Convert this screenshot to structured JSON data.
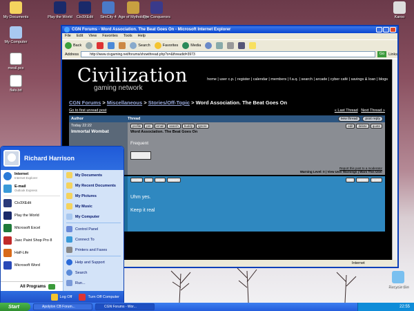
{
  "desktop": {
    "icons": [
      {
        "label": "My Documents",
        "color": "#f4d35e"
      },
      {
        "label": "My Computer",
        "color": "#a8c8f0"
      },
      {
        "label": "mesil.pcx",
        "color": "#ffffff"
      },
      {
        "label": "flats.txt",
        "color": "#ffffff"
      },
      {
        "label": "Play the World",
        "color": "#1a2a6a"
      },
      {
        "label": "Civ3XEdit",
        "color": "#1a2a6a"
      },
      {
        "label": "SimCity 4",
        "color": "#4a7ac8"
      },
      {
        "label": "Age of Mythology",
        "color": "#c8a040"
      },
      {
        "label": "The Conquerors",
        "color": "#3a3a8a"
      },
      {
        "label": "Karoo",
        "color": "#dddddd"
      },
      {
        "label": "Recycle Bin",
        "color": "#7ac0f0"
      }
    ]
  },
  "ie": {
    "title": "CGN Forums - Word Association. The Beat Goes On - Microsoft Internet Explorer",
    "menu": [
      "File",
      "Edit",
      "View",
      "Favorites",
      "Tools",
      "Help"
    ],
    "toolbar": {
      "back": "Back",
      "search": "Search",
      "favorites": "Favorites",
      "media": "Media"
    },
    "address_label": "Address",
    "address_url": "http://www.civgaming.net/forums/showthread.php?s=&threadid=3973",
    "go_label": "Go",
    "links_label": "Links",
    "status_zone": "Internet"
  },
  "forum": {
    "logo_main": "Civilization",
    "logo_sub": "gaming network",
    "nav": "home | user c.p. | register | calendar | members | f.a.q. | search | arcade | cyber café | savings & loan | blogs",
    "breadcrumb": {
      "root": "CGN Forums",
      "sep": ">",
      "c1": "Miscellaneous",
      "c2": "Stories/Off-Topic",
      "current": "Word Association. The Beat Goes On"
    },
    "first_unread": "Go to first unread post",
    "last_thread": "« Last Thread",
    "next_thread": "Next Thread »",
    "col_author": "Author",
    "col_thread": "Thread",
    "new_thread": "new thread",
    "post_reply": "post reply",
    "posts": [
      {
        "date": "Today 22:22",
        "author": "Immortal Wombat",
        "title": "Word Association. The Beat Goes On",
        "text": "Frequent",
        "report": "Report this post to a moderator",
        "warning": "Warning Level: 0 | View User Warnings | Warn This User"
      },
      {
        "text": "Uhm yes.",
        "text2": "Keep it real"
      }
    ],
    "post_buttons": [
      "profile",
      "pm",
      "email",
      "search",
      "buddy",
      "ignore"
    ],
    "edit_buttons": [
      "edit",
      "delete",
      "quote"
    ]
  },
  "start_menu": {
    "user": "Richard Harrison",
    "pinned": [
      {
        "title": "Internet",
        "sub": "Internet Explorer",
        "color": "#2a7ad8"
      },
      {
        "title": "E-mail",
        "sub": "Outlook Express",
        "color": "#3a9ad8"
      }
    ],
    "recent": [
      {
        "label": "Civ3XEdit",
        "color": "#2a3a7a"
      },
      {
        "label": "Play the World",
        "color": "#1a2a6a"
      },
      {
        "label": "Microsoft Excel",
        "color": "#1e7a3a"
      },
      {
        "label": "Jasc Paint Shop Pro 8",
        "color": "#c02a2a"
      },
      {
        "label": "Half-Life",
        "color": "#d86a1a"
      },
      {
        "label": "Microsoft Word",
        "color": "#2a4ab8"
      }
    ],
    "all_programs": "All Programs",
    "right": [
      {
        "label": "My Documents",
        "bold": true,
        "color": "#f4d35e"
      },
      {
        "label": "My Recent Documents",
        "bold": true,
        "color": "#f4d35e"
      },
      {
        "label": "My Pictures",
        "bold": true,
        "color": "#f4d35e"
      },
      {
        "label": "My Music",
        "bold": true,
        "color": "#f4d35e"
      },
      {
        "label": "My Computer",
        "bold": true,
        "color": "#a8c8f0"
      },
      {
        "label": "Control Panel",
        "bold": false,
        "color": "#6a8ad8"
      },
      {
        "label": "Connect To",
        "bold": false,
        "color": "#3a9ad8"
      },
      {
        "label": "Printers and Faxes",
        "bold": false,
        "color": "#888888"
      },
      {
        "label": "Help and Support",
        "bold": false,
        "color": "#2a6ad8"
      },
      {
        "label": "Search",
        "bold": false,
        "color": "#5a8ad8"
      },
      {
        "label": "Run...",
        "bold": false,
        "color": "#7a9ad8"
      }
    ],
    "log_off": "Log Off",
    "turn_off": "Turn Off Computer"
  },
  "taskbar": {
    "start": "Start",
    "tasks": [
      "Apolyton CB Forum...",
      "CGN Forums - Wor..."
    ],
    "clock": "22:55"
  }
}
